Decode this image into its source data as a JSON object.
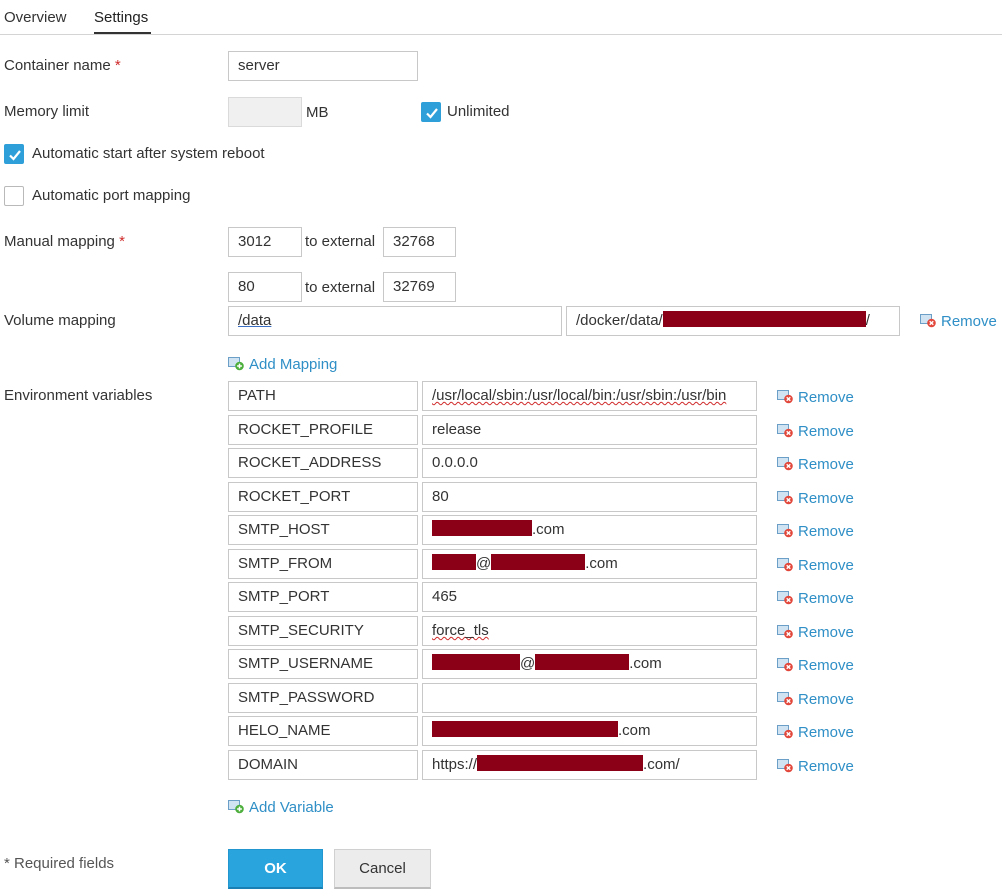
{
  "tabs": {
    "overview": "Overview",
    "settings": "Settings"
  },
  "form": {
    "container_name": {
      "label": "Container name",
      "required_mark": "*",
      "value": "server"
    },
    "memory_limit": {
      "label": "Memory limit",
      "value": "",
      "unit": "MB",
      "unlimited_label": "Unlimited",
      "unlimited_checked": true
    },
    "auto_start": {
      "label": "Automatic start after system reboot",
      "checked": true
    },
    "auto_port": {
      "label": "Automatic port mapping",
      "checked": false
    },
    "manual_mapping": {
      "label": "Manual mapping",
      "required_mark": "*",
      "to_external": "to external",
      "rows": [
        {
          "internal": "3012",
          "external": "32768"
        },
        {
          "internal": "80",
          "external": "32769"
        }
      ]
    },
    "volume_mapping": {
      "label": "Volume mapping",
      "source": "/data",
      "target_prefix": "/docker/data/",
      "target_suffix": "/",
      "remove": "Remove",
      "add": "Add Mapping"
    },
    "env": {
      "label": "Environment variables",
      "remove": "Remove",
      "add": "Add Variable",
      "rows": [
        {
          "name": "PATH",
          "value_pre": "/usr/local/sbin:/usr/local/bin:/usr/sbin:/usr/bin"
        },
        {
          "name": "ROCKET_PROFILE",
          "value_pre": "release"
        },
        {
          "name": "ROCKET_ADDRESS",
          "value_pre": "0.0.0.0"
        },
        {
          "name": "ROCKET_PORT",
          "value_pre": "80"
        },
        {
          "name": "SMTP_HOST",
          "value_post": ".com"
        },
        {
          "name": "SMTP_FROM",
          "value_mid": "@",
          "value_post": ".com"
        },
        {
          "name": "SMTP_PORT",
          "value_pre": "465"
        },
        {
          "name": "SMTP_SECURITY",
          "value_pre": "force_tls"
        },
        {
          "name": "SMTP_USERNAME",
          "value_mid": "@",
          "value_post": ".com"
        },
        {
          "name": "SMTP_PASSWORD",
          "value_pre": ""
        },
        {
          "name": "HELO_NAME",
          "value_post": ".com"
        },
        {
          "name": "DOMAIN",
          "value_pre": "https://",
          "value_post": ".com/"
        }
      ]
    },
    "required_note": "* Required fields",
    "ok": "OK",
    "cancel": "Cancel"
  },
  "colors": {
    "accent": "#2e9fd8",
    "link": "#2f8fc6",
    "redaction": "#8b0016",
    "required": "#d02a2a"
  },
  "icons": {
    "check": "check-icon",
    "remove": "remove-icon",
    "add": "add-icon"
  }
}
